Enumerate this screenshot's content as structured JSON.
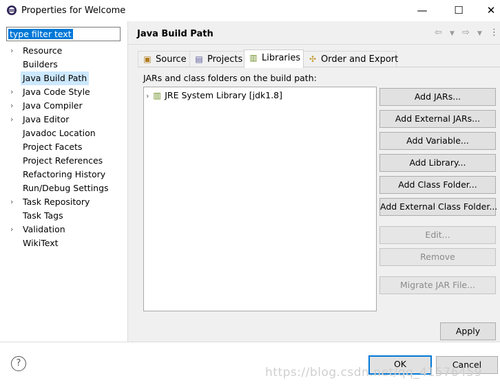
{
  "window": {
    "title": "Properties for Welcome",
    "minimize": "—",
    "maximize": "☐",
    "close": "✕"
  },
  "filter": {
    "text": "type filter text"
  },
  "nav": [
    {
      "label": "Resource",
      "expandable": true
    },
    {
      "label": "Builders",
      "expandable": false
    },
    {
      "label": "Java Build Path",
      "expandable": false,
      "selected": true
    },
    {
      "label": "Java Code Style",
      "expandable": true
    },
    {
      "label": "Java Compiler",
      "expandable": true
    },
    {
      "label": "Java Editor",
      "expandable": true
    },
    {
      "label": "Javadoc Location",
      "expandable": false
    },
    {
      "label": "Project Facets",
      "expandable": false
    },
    {
      "label": "Project References",
      "expandable": false
    },
    {
      "label": "Refactoring History",
      "expandable": false
    },
    {
      "label": "Run/Debug Settings",
      "expandable": false
    },
    {
      "label": "Task Repository",
      "expandable": true
    },
    {
      "label": "Task Tags",
      "expandable": false
    },
    {
      "label": "Validation",
      "expandable": true
    },
    {
      "label": "WikiText",
      "expandable": false
    }
  ],
  "page": {
    "title": "Java Build Path"
  },
  "tabs": [
    {
      "label": "Source",
      "icon": "source-folder-icon"
    },
    {
      "label": "Projects",
      "icon": "projects-icon"
    },
    {
      "label": "Libraries",
      "icon": "libraries-icon",
      "active": true
    },
    {
      "label": "Order and Export",
      "icon": "order-export-icon"
    }
  ],
  "libraries": {
    "label": "JARs and class folders on the build path:",
    "tree": [
      {
        "label": "JRE System Library [jdk1.8]"
      }
    ]
  },
  "buttons": {
    "add_jars": "Add JARs...",
    "add_external_jars": "Add External JARs...",
    "add_variable": "Add Variable...",
    "add_library": "Add Library...",
    "add_class_folder": "Add Class Folder...",
    "add_external_class_folder": "Add External Class Folder...",
    "edit": "Edit...",
    "remove": "Remove",
    "migrate_jar": "Migrate JAR File...",
    "apply": "Apply",
    "ok": "OK",
    "cancel": "Cancel",
    "help": "?"
  },
  "watermark": "https://blog.csdn.net/qq_41576459",
  "colors": {
    "selection": "#0078d7",
    "nav_selected": "#cce8ff"
  }
}
